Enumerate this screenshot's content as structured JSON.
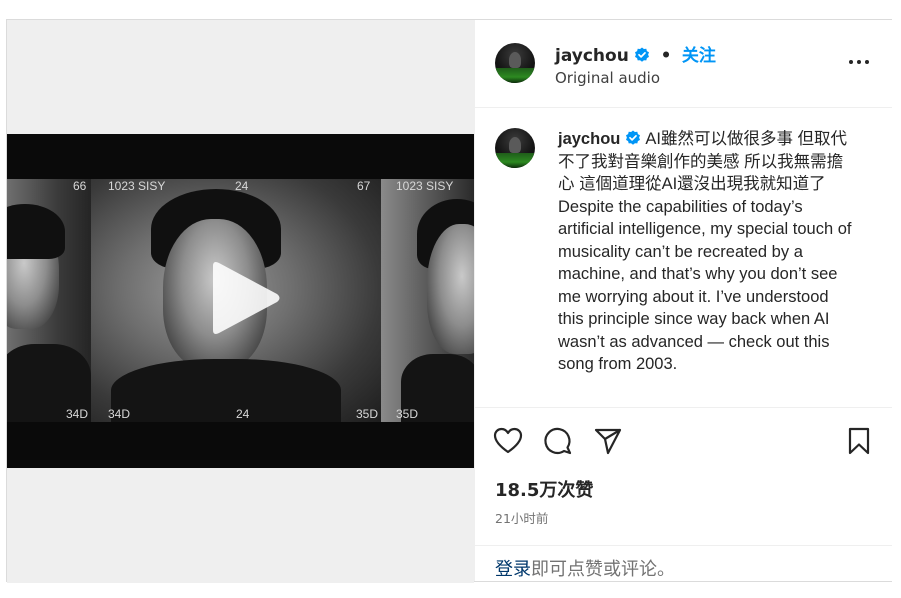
{
  "colors": {
    "accent_blue": "#0095f6",
    "link_dark_blue": "#00376b",
    "secondary_text": "#737373",
    "border": "#dbdbdb"
  },
  "header": {
    "username": "jaychou",
    "verified_icon": "verified-badge-icon",
    "separator": "•",
    "follow_label": "关注",
    "audio_label": "Original audio",
    "more_icon": "more-horizontal-icon"
  },
  "video": {
    "play_icon": "play-icon",
    "frame_codes_top": [
      "66",
      "1023 SISY",
      "24",
      "67",
      "1023 SISY"
    ],
    "frame_codes_bottom": [
      "34D",
      "34D",
      "24",
      "35D",
      "35D"
    ]
  },
  "caption": {
    "username": "jaychou",
    "text": "AI雖然可以做很多事 但取代不了我對音樂創作的美感 所以我無需擔心 這個道理從AI還沒出現我就知道了 Despite the capabilities of today’s artificial intelligence, my special touch of musicality can’t be recreated by a machine, and that’s why you don’t see me worrying about it. I’ve understood this principle since way back when AI wasn’t as advanced — check out this song from 2003."
  },
  "actions": {
    "like_icon": "heart-icon",
    "comment_icon": "comment-icon",
    "share_icon": "share-icon",
    "save_icon": "bookmark-icon"
  },
  "stats": {
    "likes": "18.5万次赞",
    "time_ago": "21小时前"
  },
  "login": {
    "link_label": "登录",
    "rest_label": "即可点赞或评论。"
  }
}
